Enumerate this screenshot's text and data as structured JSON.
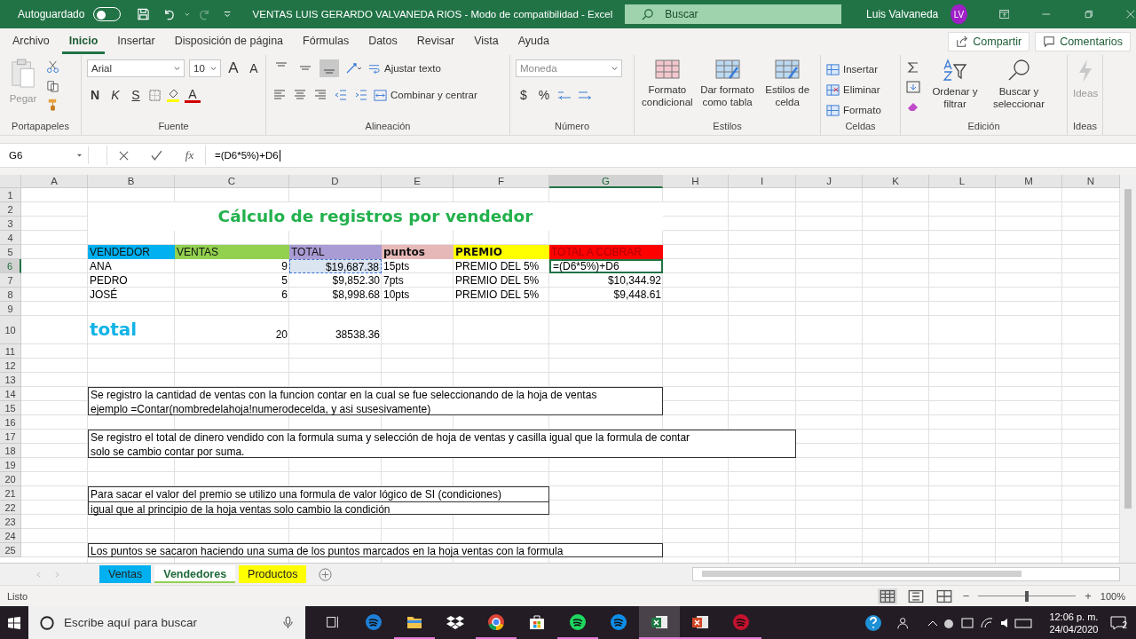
{
  "titlebar": {
    "autosave": "Autoguardado",
    "autosave_on": false,
    "title": "VENTAS LUIS GERARDO VALVANEDA RIOS  -  Modo de compatibilidad  -  Excel",
    "search": {
      "placeholder": "Buscar"
    },
    "user": "Luis Valvaneda",
    "initials": "LV"
  },
  "tabs": [
    {
      "label": "Archivo",
      "selected": false
    },
    {
      "label": "Inicio",
      "selected": true
    },
    {
      "label": "Insertar",
      "selected": false
    },
    {
      "label": "Disposición de página",
      "selected": false
    },
    {
      "label": "Fórmulas",
      "selected": false
    },
    {
      "label": "Datos",
      "selected": false
    },
    {
      "label": "Revisar",
      "selected": false
    },
    {
      "label": "Vista",
      "selected": false
    },
    {
      "label": "Ayuda",
      "selected": false
    }
  ],
  "share": "Compartir",
  "comments": "Comentarios",
  "ribbon": {
    "groups": [
      {
        "kind": "clipboard",
        "label": "Portapapeles",
        "paste": "Pegar"
      },
      {
        "kind": "font",
        "label": "Fuente",
        "font": "Arial",
        "size": "10",
        "grow": "A",
        "shrink": "A",
        "bold": "N",
        "italic": "K",
        "underline": "S",
        "color_letter": "A"
      },
      {
        "kind": "alignment",
        "label": "Alineación",
        "vertical_align": [
          {
            "selected": false
          },
          {
            "selected": false
          },
          {
            "selected": true
          }
        ],
        "wrap": "Ajustar texto",
        "merge": "Combinar y centrar"
      },
      {
        "kind": "number",
        "label": "Número",
        "format": "Moneda",
        "currency": "$",
        "percent": "%"
      },
      {
        "kind": "styles",
        "label": "Estilos",
        "buttons": [
          "Formato condicional",
          "Dar formato como tabla",
          "Estilos de celda"
        ]
      },
      {
        "kind": "cells",
        "label": "Celdas",
        "buttons": [
          "Insertar",
          "Eliminar",
          "Formato"
        ]
      },
      {
        "kind": "editing",
        "label": "Edición",
        "buttons": [
          "Ordenar y filtrar",
          "Buscar y seleccionar"
        ]
      },
      {
        "kind": "ideas",
        "label": "Ideas",
        "button": "Ideas"
      }
    ]
  },
  "formula_bar": {
    "name_box": "G6",
    "function_label": "fx",
    "formula": "=(D6*5%)+D6"
  },
  "sheet": {
    "columns": [
      "A",
      "B",
      "C",
      "D",
      "E",
      "F",
      "G",
      "H",
      "I",
      "J",
      "K",
      "L",
      "M",
      "N"
    ],
    "rows": [
      "1",
      "2",
      "3",
      "4",
      "5",
      "6",
      "7",
      "8",
      "9",
      "10",
      "11",
      "12",
      "13",
      "14",
      "15",
      "16",
      "17",
      "18",
      "19",
      "20",
      "21",
      "22",
      "23",
      "24",
      "25"
    ],
    "title": "Cálculo de registros por vendedor",
    "table": {
      "header": [
        {
          "text": "VENDEDOR",
          "kind": "plain",
          "color": "#00b0f0"
        },
        {
          "text": "VENTAS",
          "kind": "plain",
          "color": "#92d050"
        },
        {
          "text": "TOTAL",
          "kind": "plain",
          "color": "#a99bd3"
        },
        {
          "text": "puntos",
          "kind": "strong",
          "color": "#e6b9b8"
        },
        {
          "text": "PREMIO",
          "kind": "strong",
          "color": "#ffff00"
        },
        {
          "text": "TOTAL A COBRAR",
          "kind": "alert",
          "color": "#ff0000"
        }
      ],
      "rows": [
        {
          "cells": [
            {
              "text": "ANA",
              "kind": "text",
              "selected": false,
              "referenced": false
            },
            {
              "text": "9",
              "kind": "number",
              "selected": false,
              "referenced": false
            },
            {
              "text": "$19,687.38",
              "kind": "number",
              "selected": false,
              "referenced": true
            },
            {
              "text": "15pts",
              "kind": "text",
              "selected": false,
              "referenced": false
            },
            {
              "text": "PREMIO DEL 5%",
              "kind": "text",
              "selected": false,
              "referenced": false
            },
            {
              "text": "=(D6*5%)+D6",
              "kind": "text",
              "selected": true,
              "referenced": false
            }
          ]
        },
        {
          "cells": [
            {
              "text": "PEDRO",
              "kind": "text",
              "selected": false,
              "referenced": false
            },
            {
              "text": "5",
              "kind": "number",
              "selected": false,
              "referenced": false
            },
            {
              "text": "$9,852.30",
              "kind": "number",
              "selected": false,
              "referenced": false
            },
            {
              "text": "7pts",
              "kind": "text",
              "selected": false,
              "referenced": false
            },
            {
              "text": "PREMIO DEL 5%",
              "kind": "text",
              "selected": false,
              "referenced": false
            },
            {
              "text": "$10,344.92",
              "kind": "number",
              "selected": false,
              "referenced": false
            }
          ]
        },
        {
          "cells": [
            {
              "text": "JOSÉ",
              "kind": "text",
              "selected": false,
              "referenced": false
            },
            {
              "text": "6",
              "kind": "number",
              "selected": false,
              "referenced": false
            },
            {
              "text": "$8,998.68",
              "kind": "number",
              "selected": false,
              "referenced": false
            },
            {
              "text": "10pts",
              "kind": "text",
              "selected": false,
              "referenced": false
            },
            {
              "text": "PREMIO DEL 5%",
              "kind": "text",
              "selected": false,
              "referenced": false
            },
            {
              "text": "$9,448.61",
              "kind": "number",
              "selected": false,
              "referenced": false
            }
          ]
        }
      ]
    },
    "total": {
      "label": "total",
      "values": [
        "20",
        "38538.36"
      ]
    },
    "notes": [
      {
        "kind": "plain",
        "lines": [
          "Se registro la cantidad de ventas con la funcion contar en la cual se fue seleccionando de la hoja de ventas",
          "ejemplo =Contar(nombredelahoja!numerodecelda, y asi susesivamente)"
        ]
      },
      {
        "kind": "plain",
        "lines": [
          "Se registro el total de dinero vendido con la formula suma y selección de hoja de ventas y casilla igual que la formula de contar",
          "solo se cambio contar por suma."
        ]
      },
      {
        "kind": "ruled",
        "lines": [
          "Para sacar el valor del premio se utilizo una formula de valor lógico de SI (condiciones)",
          "igual que al principio de la hoja ventas solo cambio la condición"
        ]
      },
      {
        "kind": "plain",
        "lines": [
          "Los puntos se sacaron haciendo una suma de los puntos marcados en la hoja ventas con la formula"
        ]
      }
    ]
  },
  "sheet_tabs": [
    {
      "label": "Ventas",
      "color": "#00b0f0",
      "selected": false
    },
    {
      "label": "Vendedores",
      "color": "#92d050",
      "selected": true
    },
    {
      "label": "Productos",
      "color": "#ffff00",
      "selected": false
    }
  ],
  "status": {
    "text": "Listo",
    "views": [
      {
        "selected": true
      },
      {
        "selected": false
      },
      {
        "selected": false
      }
    ],
    "zoom": {
      "out": "−",
      "in": "+",
      "level": 0.5,
      "reading": "100%"
    }
  },
  "taskbar": {
    "search": {
      "placeholder": "Escribe aquí para buscar"
    },
    "apps": [
      {
        "kind": "taskview",
        "running": false,
        "selected": false
      },
      {
        "kind": "edge",
        "running": false,
        "selected": false
      },
      {
        "kind": "folder",
        "running": true,
        "selected": false
      },
      {
        "kind": "dropbox",
        "running": false,
        "selected": false
      },
      {
        "kind": "chrome",
        "running": true,
        "selected": false
      },
      {
        "kind": "store",
        "running": false,
        "selected": false
      },
      {
        "kind": "spotify",
        "running": true,
        "selected": false
      },
      {
        "kind": "teamviewer",
        "running": false,
        "selected": false
      },
      {
        "kind": "excel",
        "running": true,
        "selected": true
      },
      {
        "kind": "powerpoint",
        "running": true,
        "selected": false
      },
      {
        "kind": "recorder",
        "running": true,
        "selected": false
      }
    ],
    "time": "12:06 p. m.",
    "date": "24/04/2020",
    "notifications": "2"
  }
}
